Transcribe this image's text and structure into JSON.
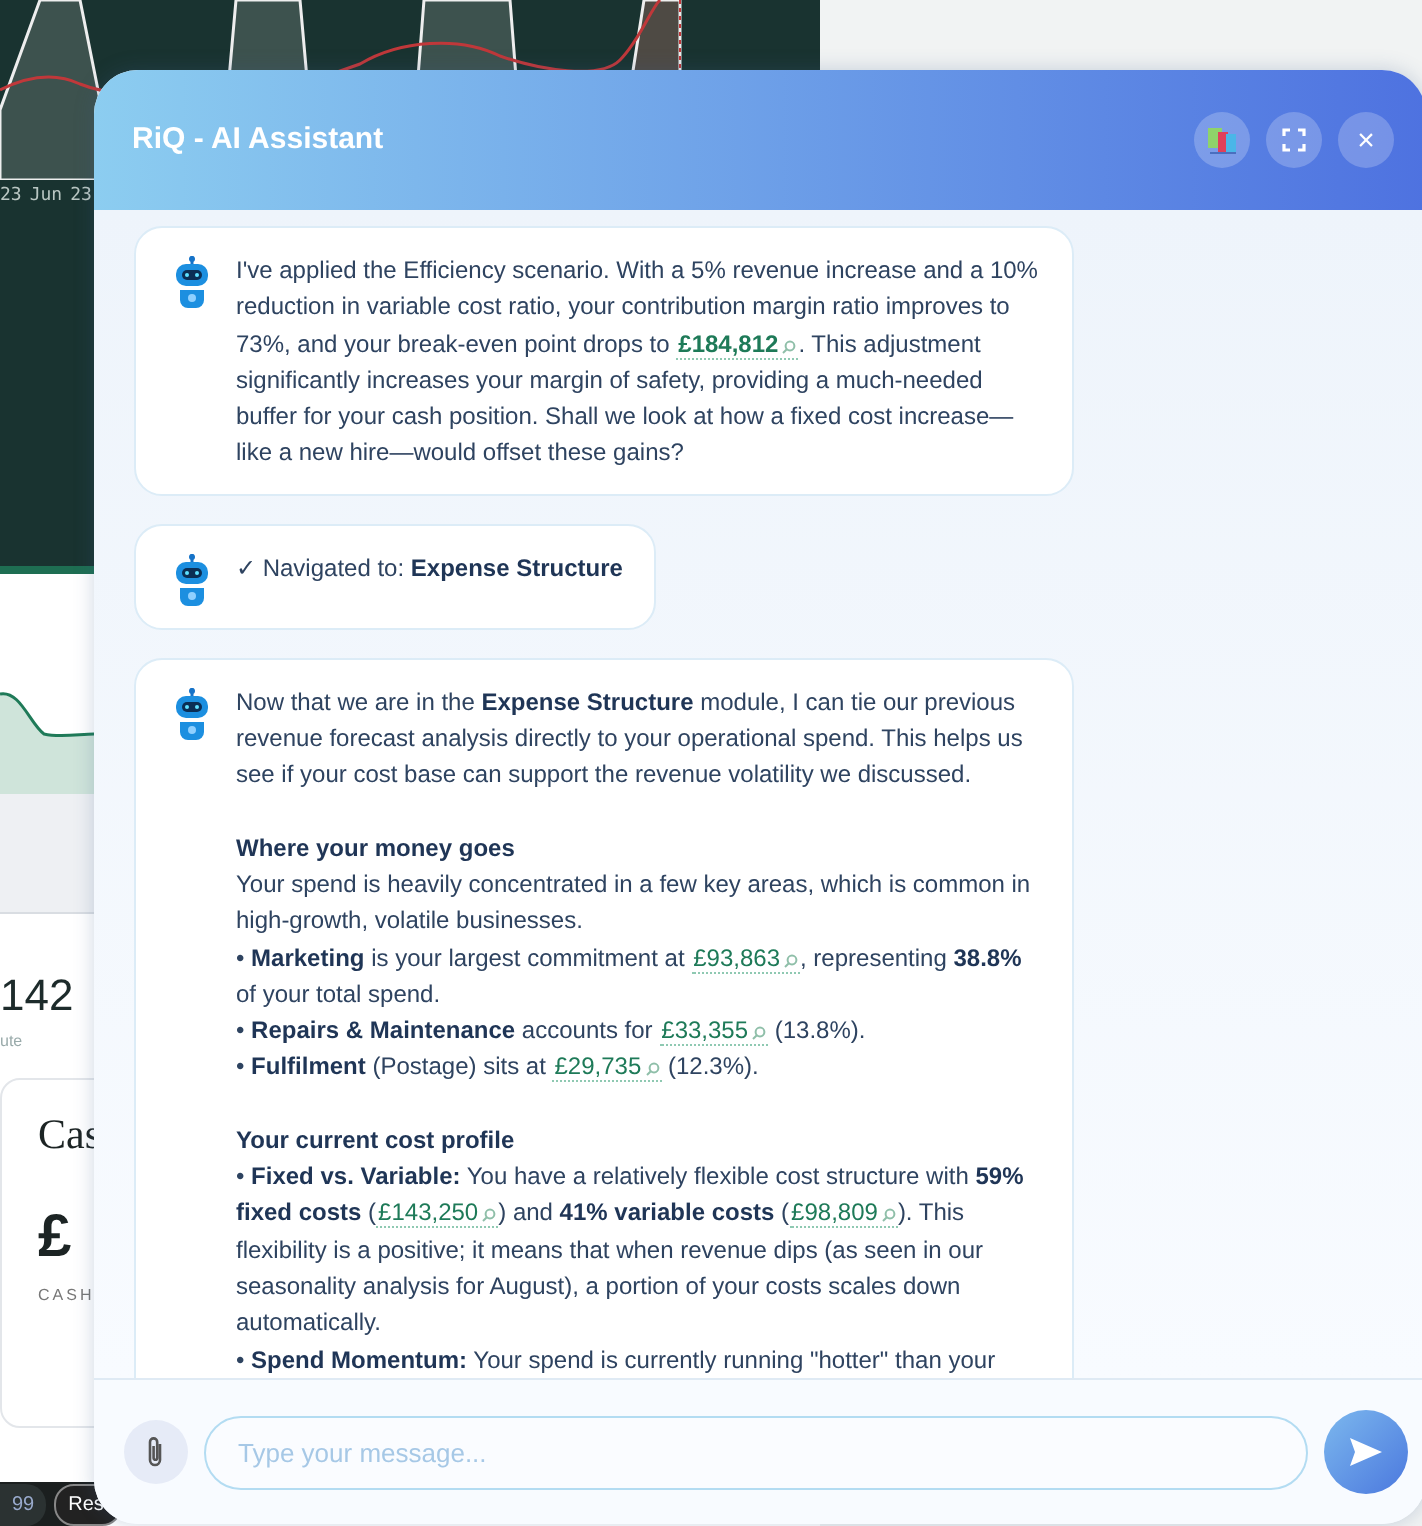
{
  "background": {
    "axis_labels": [
      "23",
      "Jun",
      "23"
    ],
    "stat_value": "142",
    "stat_caption": "ute",
    "card_title": "Cas",
    "card_value": "£",
    "card_caption": "CASH",
    "footer_badge": "99",
    "footer_button": "Res"
  },
  "assistant": {
    "title": "RiQ - AI Assistant",
    "close_label": "×",
    "messages": [
      {
        "kind": "assistant",
        "blocks": [
          {
            "kind": "paragraph",
            "parts": [
              {
                "kind": "text",
                "text": "I've applied the Efficiency scenario. With a 5% revenue increase and a 10% reduction in variable cost ratio, your contribution margin ratio improves to 73%, and your break-even point drops to "
              },
              {
                "kind": "money",
                "text": "£184,812",
                "strong": true
              },
              {
                "kind": "text",
                "text": ". This adjustment significantly increases your margin of safety, providing a much-needed buffer for your cash position. Shall we look at how a fixed cost increase—like a new hire—would offset these gains?"
              }
            ]
          }
        ]
      },
      {
        "kind": "assistant",
        "blocks": [
          {
            "kind": "paragraph",
            "parts": [
              {
                "kind": "text",
                "text": "✓ Navigated to: **Expense Structure**"
              }
            ]
          }
        ]
      },
      {
        "kind": "assistant",
        "blocks": [
          {
            "kind": "paragraph",
            "parts": [
              {
                "kind": "text",
                "text": "Now that we are in the **Expense Structure** module, I can tie our previous revenue forecast analysis directly to your operational spend. This helps us see if your cost base can support the revenue volatility we discussed."
              }
            ]
          },
          {
            "kind": "heading",
            "parts": [
              {
                "kind": "text",
                "text": "Where your money goes"
              }
            ]
          },
          {
            "kind": "paragraph",
            "parts": [
              {
                "kind": "text",
                "text": "Your spend is heavily concentrated in a few key areas, which is common in high-growth, volatile businesses."
              }
            ]
          },
          {
            "kind": "paragraph",
            "parts": [
              {
                "kind": "text",
                "text": "• **Marketing** is your largest commitment at "
              },
              {
                "kind": "money",
                "text": "£93,863",
                "strong": false
              },
              {
                "kind": "text",
                "text": ", representing **38.8%** of your total spend."
              }
            ]
          },
          {
            "kind": "paragraph",
            "parts": [
              {
                "kind": "text",
                "text": "• **Repairs & Maintenance** accounts for "
              },
              {
                "kind": "money",
                "text": "£33,355",
                "strong": false
              },
              {
                "kind": "text",
                "text": " (13.8%)."
              }
            ]
          },
          {
            "kind": "paragraph",
            "parts": [
              {
                "kind": "text",
                "text": "• **Fulfilment** (Postage) sits at "
              },
              {
                "kind": "money",
                "text": "£29,735",
                "strong": false
              },
              {
                "kind": "text",
                "text": " (12.3%)."
              }
            ]
          },
          {
            "kind": "heading",
            "parts": [
              {
                "kind": "text",
                "text": "Your current cost profile"
              }
            ]
          },
          {
            "kind": "paragraph",
            "parts": [
              {
                "kind": "text",
                "text": "• **Fixed vs. Variable:** You have a relatively flexible cost structure with **59% fixed costs** ("
              },
              {
                "kind": "money",
                "text": "£143,250",
                "strong": false
              },
              {
                "kind": "text",
                "text": ") and **41% variable costs** ("
              },
              {
                "kind": "money",
                "text": "£98,809",
                "strong": false
              },
              {
                "kind": "text",
                "text": "). This flexibility is a positive; it means that when revenue dips (as seen in our seasonality analysis for August), a portion of your costs scales down automatically."
              }
            ]
          },
          {
            "kind": "paragraph",
            "parts": [
              {
                "kind": "text",
                "text": "• **Spend Momentum:** Your spend is currently running \"hotter\" than your"
              }
            ]
          }
        ]
      }
    ],
    "input": {
      "placeholder": "Type your message..."
    }
  }
}
